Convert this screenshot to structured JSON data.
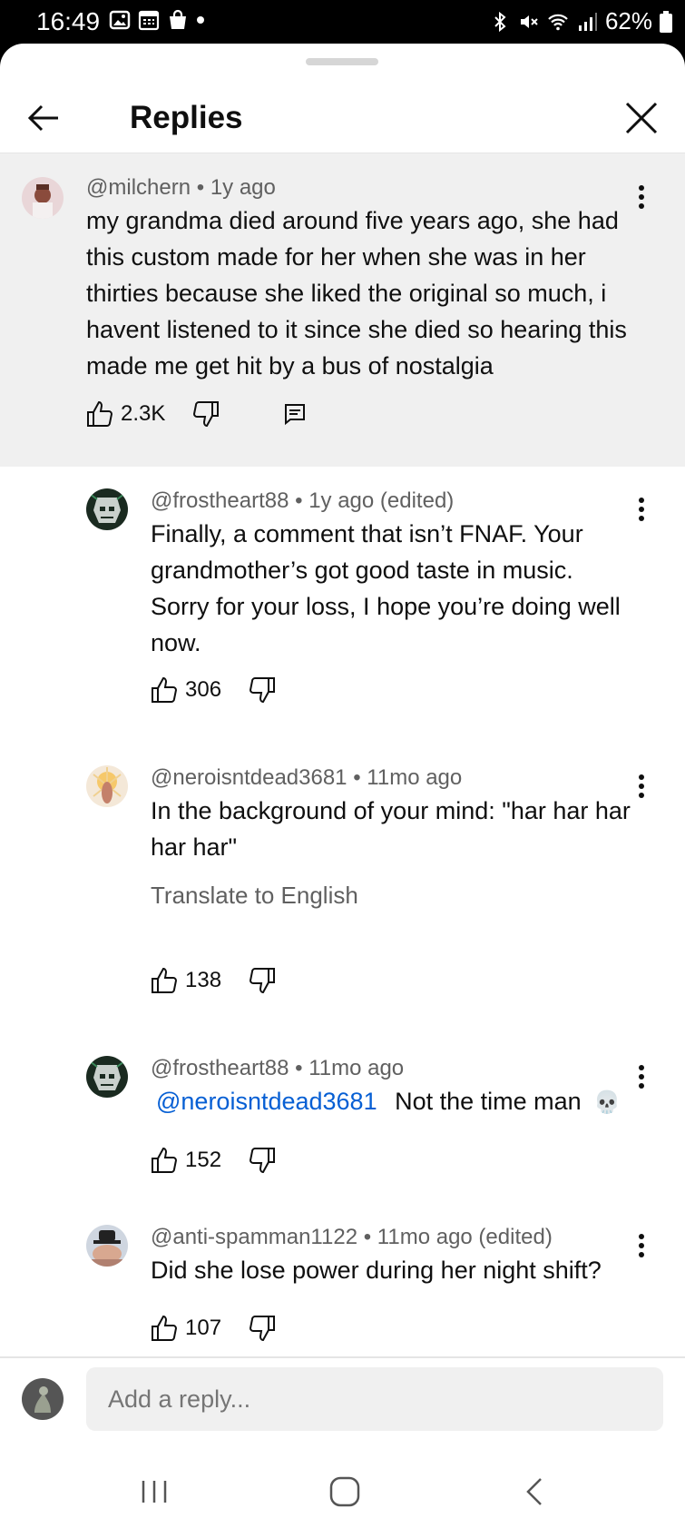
{
  "status_bar": {
    "time": "16:49",
    "battery": "62%",
    "left_icons": [
      "gallery-icon",
      "calendar-icon",
      "shopping-bag-icon",
      "dot-icon"
    ],
    "right_icons": [
      "bluetooth-icon",
      "mute-icon",
      "wifi-icon",
      "signal-icon",
      "battery-icon"
    ]
  },
  "header": {
    "title": "Replies"
  },
  "parent_comment": {
    "author": "@milchern",
    "age": "1y ago",
    "text_lines": [
      "my grandma died around five years ago, she had",
      "this custom made for her when she was in her",
      "thirties because she liked the original so much, i",
      "havent listened to it since she died so hearing this",
      "made me get hit by a bus of nostalgia"
    ],
    "likes": "2.3K"
  },
  "replies": [
    {
      "author": "@frostheart88",
      "age": "1y ago (edited)",
      "text_lines": [
        "Finally, a comment that isn’t FNAF. Your",
        "grandmother’s got good taste in music.",
        "Sorry for your loss, I hope you’re doing well",
        "now."
      ],
      "likes": "306"
    },
    {
      "author": "@neroisntdead3681",
      "age": "11mo ago",
      "text_lines": [
        "In the background of your mind: \"har har har",
        "har har\""
      ],
      "translate": "Translate to English",
      "likes": "138"
    },
    {
      "author": "@frostheart88",
      "age": "11mo ago",
      "mention": "@neroisntdead3681",
      "text": "Not the time man",
      "emoji": "💀",
      "likes": "152"
    },
    {
      "author": "@anti-spamman1122",
      "age": "11mo ago (edited)",
      "text_lines": [
        "Did she lose power during her night shift?"
      ],
      "likes": "107"
    }
  ],
  "composer": {
    "placeholder": "Add a reply..."
  },
  "colors": {
    "highlight_bg": "#f0f0f0",
    "link": "#065fd4",
    "meta_text": "#606060"
  }
}
